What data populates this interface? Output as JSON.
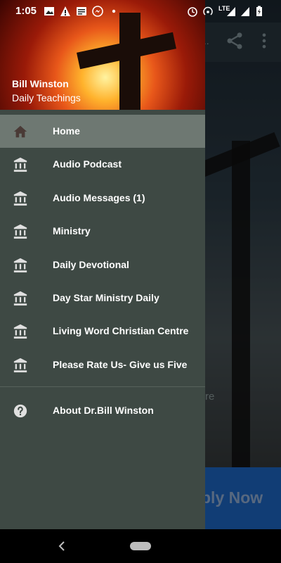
{
  "status_bar": {
    "time": "1:05",
    "network_label": "LTE"
  },
  "drawer": {
    "header_title": "Bill Winston",
    "header_subtitle": "Daily Teachings",
    "items": [
      {
        "label": "Home",
        "icon": "home-icon",
        "selected": true
      },
      {
        "label": "Audio Podcast",
        "icon": "bank-icon"
      },
      {
        "label": "Audio Messages (1)",
        "icon": "bank-icon"
      },
      {
        "label": "Ministry",
        "icon": "bank-icon"
      },
      {
        "label": "Daily Devotional",
        "icon": "bank-icon"
      },
      {
        "label": "Day Star Ministry Daily",
        "icon": "bank-icon"
      },
      {
        "label": "Living Word Christian Centre",
        "icon": "bank-icon"
      },
      {
        "label": "Please Rate Us- Give us Five",
        "icon": "bank-icon"
      }
    ],
    "about_label": "About Dr.Bill Winston"
  },
  "background": {
    "toolbar_title_fragment": "...",
    "faded_text": "re",
    "banner_text": "ply Now"
  },
  "colors": {
    "drawer_bg": "#3e4944",
    "selected_bg": "#6e7872",
    "banner": "#1f6fd6"
  }
}
